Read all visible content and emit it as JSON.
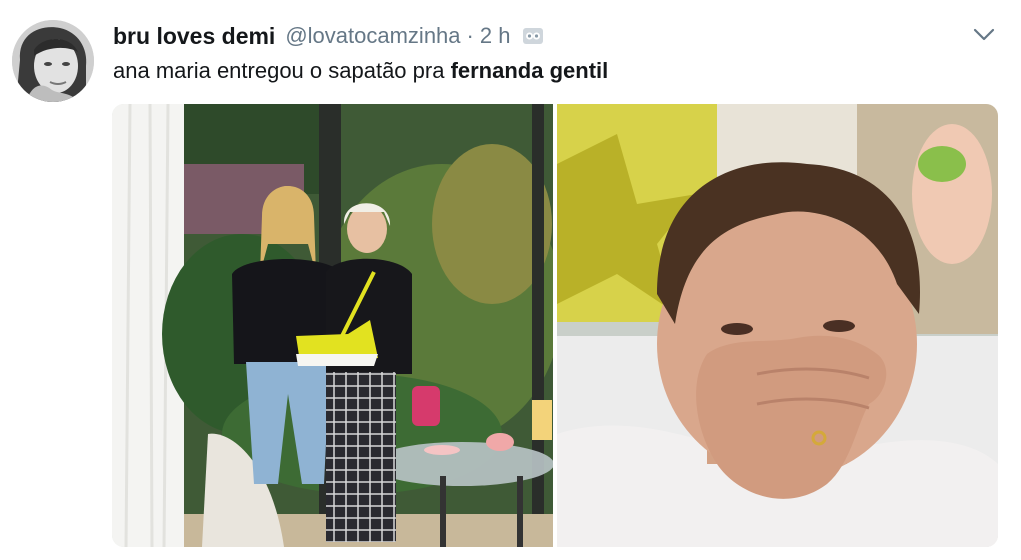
{
  "tweet": {
    "display_name": "bru loves demi",
    "handle": "@lovatocamzinha",
    "separator": "·",
    "time": "2 h",
    "text_prefix": "ana maria entregou o sapatão pra ",
    "text_bold": "fernanda gentil"
  },
  "colors": {
    "text": "#14171a",
    "secondary": "#657786",
    "background": "#ffffff"
  },
  "icons": {
    "avatar": "user-avatar",
    "app_badge": "app-badge-icon",
    "caret": "chevron-down-icon"
  },
  "media": {
    "left_photo": "two women holding a yellow sneaker-shaped bag on a tv set",
    "right_photo": "woman covering her mouth with her hand"
  }
}
